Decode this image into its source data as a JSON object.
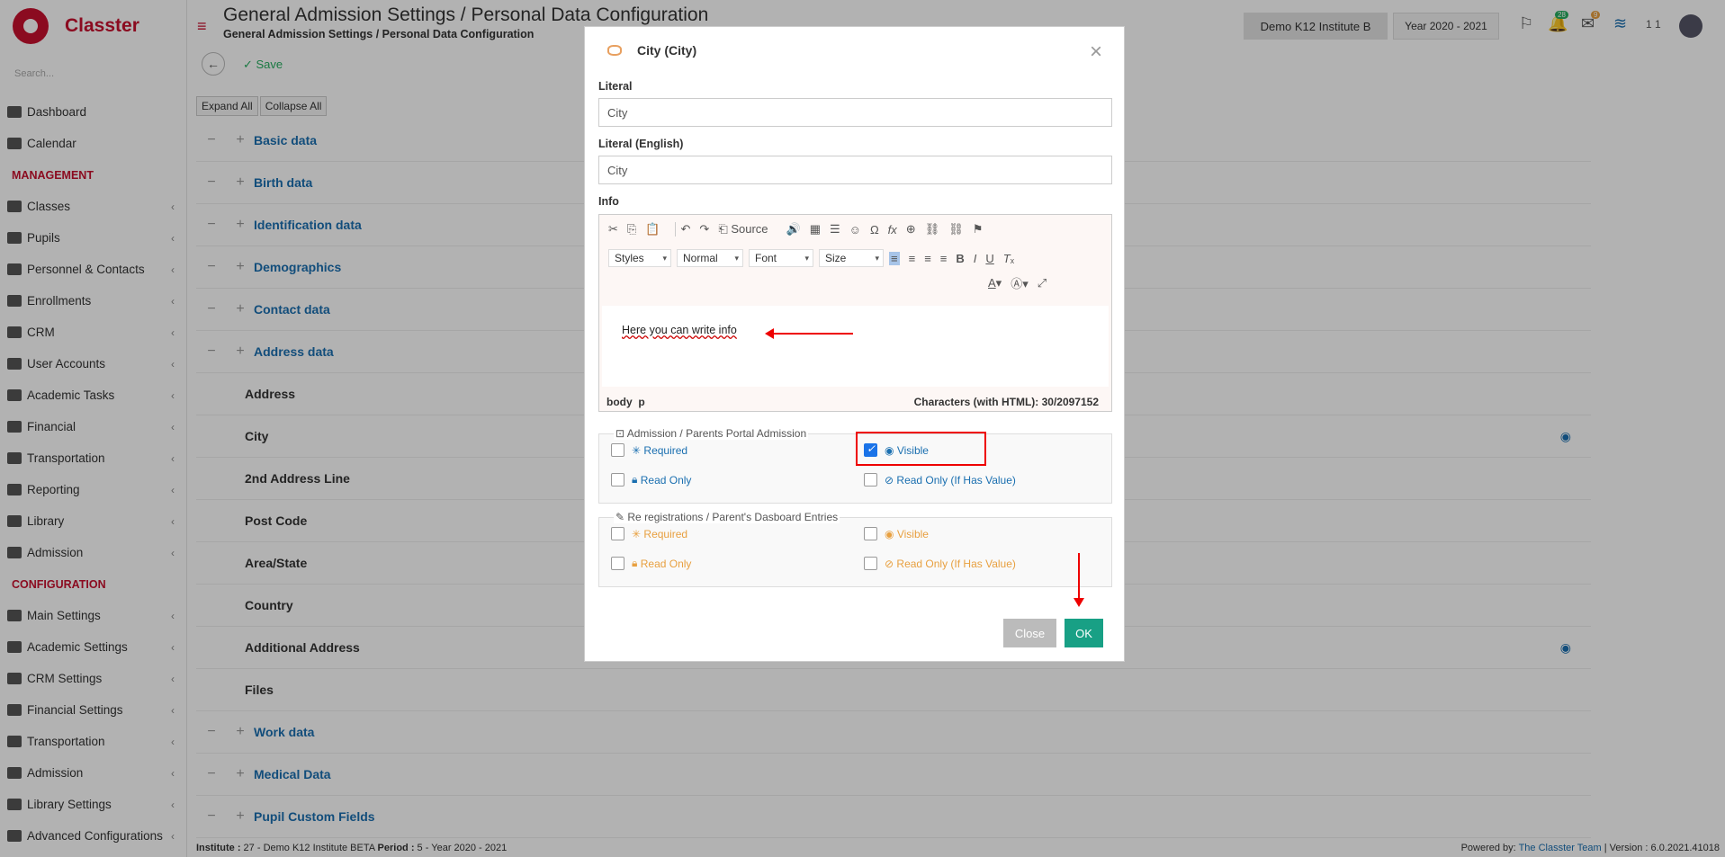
{
  "app": {
    "brand": "Classter"
  },
  "sidebar": {
    "search_placeholder": "Search...",
    "items": [
      {
        "label": "Dashboard",
        "icon": "laptop-icon"
      },
      {
        "label": "Calendar",
        "icon": "calendar-icon"
      },
      {
        "section": "MANAGEMENT"
      },
      {
        "label": "Classes",
        "icon": "grid-icon"
      },
      {
        "label": "Pupils",
        "icon": "users-icon"
      },
      {
        "label": "Personnel & Contacts",
        "icon": "user-icon"
      },
      {
        "label": "Enrollments",
        "icon": "exchange-icon"
      },
      {
        "label": "CRM",
        "icon": "chart-icon"
      },
      {
        "label": "User Accounts",
        "icon": "key-icon"
      },
      {
        "label": "Academic Tasks",
        "icon": "list-icon"
      },
      {
        "label": "Financial",
        "icon": "money-icon"
      },
      {
        "label": "Transportation",
        "icon": "bus-icon"
      },
      {
        "label": "Reporting",
        "icon": "print-icon"
      },
      {
        "label": "Library",
        "icon": "books-icon"
      },
      {
        "label": "Admission",
        "icon": "bank-icon"
      },
      {
        "section": "CONFIGURATION"
      },
      {
        "label": "Main Settings",
        "icon": "cog-icon"
      },
      {
        "label": "Academic Settings",
        "icon": "grid-icon"
      },
      {
        "label": "CRM Settings",
        "icon": "chart-icon"
      },
      {
        "label": "Financial Settings",
        "icon": "money-icon"
      },
      {
        "label": "Transportation",
        "icon": "bus-icon"
      },
      {
        "label": "Admission",
        "icon": "bank-icon"
      },
      {
        "label": "Library Settings",
        "icon": "books-icon"
      },
      {
        "label": "Advanced Configurations",
        "icon": "cogs-icon"
      }
    ]
  },
  "header": {
    "title": "General Admission Settings / Personal Data Configuration",
    "subtitle": "General Admission Settings / Personal Data Configuration",
    "institute": "Demo K12 Institute B",
    "year": "Year 2020 - 2021",
    "badge_green": "28",
    "badge_orange": "9",
    "user": "1 1"
  },
  "toolbar": {
    "save": "Save",
    "expand": "Expand All",
    "collapse": "Collapse All"
  },
  "rows": [
    {
      "label": "Basic data",
      "group": true
    },
    {
      "label": "Birth data",
      "group": true
    },
    {
      "label": "Identification data",
      "group": true
    },
    {
      "label": "Demographics",
      "group": true
    },
    {
      "label": "Contact data",
      "group": true
    },
    {
      "label": "Address data",
      "group": true
    },
    {
      "label": "Address",
      "group": false
    },
    {
      "label": "City",
      "group": false,
      "eye": true
    },
    {
      "label": "2nd Address Line",
      "group": false
    },
    {
      "label": "Post Code",
      "group": false
    },
    {
      "label": "Area/State",
      "group": false
    },
    {
      "label": "Country",
      "group": false
    },
    {
      "label": "Additional Address",
      "group": false,
      "eye": true
    },
    {
      "label": "Files",
      "group": false
    },
    {
      "label": "Work data",
      "group": true
    },
    {
      "label": "Medical Data",
      "group": true
    },
    {
      "label": "Pupil Custom Fields",
      "group": true
    }
  ],
  "footer": {
    "left_prefix1": "Institute :",
    "left_val1": " 27 - Demo K12 Institute BETA ",
    "left_prefix2": "Period :",
    "left_val2": " 5 - Year 2020 - 2021",
    "powered": "Powered by:",
    "team": "The Classter Team",
    "version": "| Version : 6.0.2021.41018"
  },
  "modal": {
    "title": "City (City)",
    "literal_label": "Literal",
    "literal_value": "City",
    "literal_en_label": "Literal (English)",
    "literal_en_value": "City",
    "info_label": "Info",
    "source": "Source",
    "styles": "Styles",
    "format": "Normal",
    "font": "Font",
    "size": "Size",
    "editor_text": "Here you can write info",
    "path_body": "body",
    "path_p": "p",
    "char_count": "Characters (with HTML): 30/2097152",
    "group1_title": "Admission / Parents Portal Admission",
    "group2_title": "Re registrations / Parent's Dasboard Entries",
    "required": "Required",
    "visible": "Visible",
    "read_only": "Read Only",
    "read_only_if": "Read Only (If Has Value)",
    "close": "Close",
    "ok": "OK"
  },
  "colors": {
    "brand": "#c8102e",
    "link": "#1a6fb0",
    "ok": "#18a085",
    "annotation": "#e00000"
  }
}
